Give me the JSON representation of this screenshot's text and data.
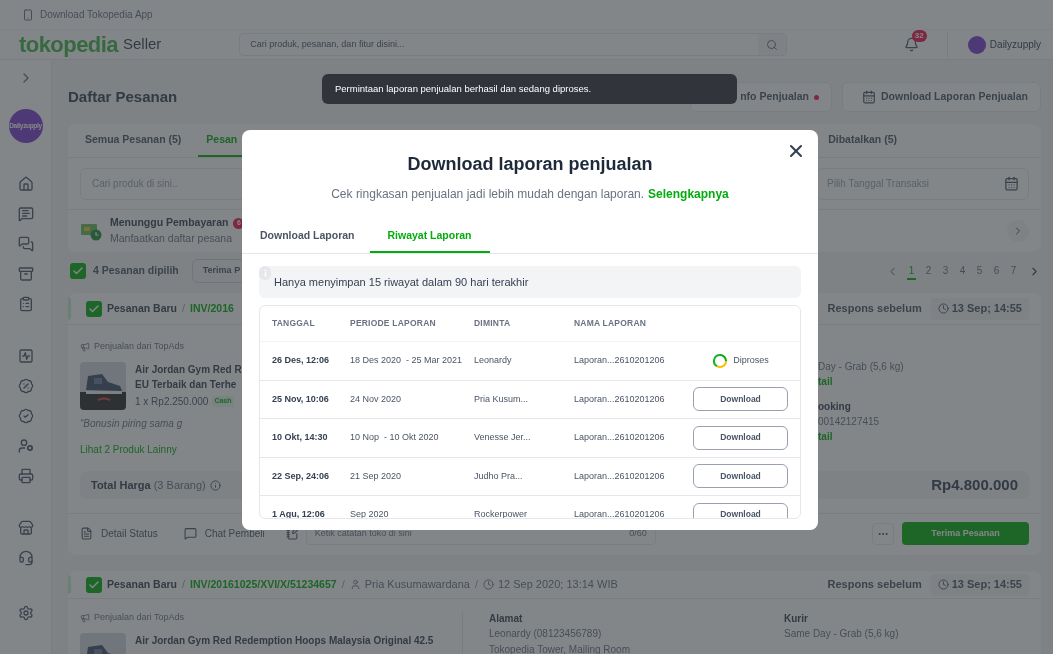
{
  "app_banner": {
    "text": "Download Tokopedia App"
  },
  "header": {
    "logo": "tokopedia",
    "logo_suffix": "Seller",
    "search": {
      "placeholder": "Cari produk, pesanan, dan fitur disini..."
    },
    "notification_count": "32",
    "shop": {
      "name": "Dailyzupply"
    }
  },
  "sidebar": {
    "avatar_label": "Dailyzupply"
  },
  "page": {
    "title": "Daftar Pesanan",
    "actions": [
      {
        "label": "nfo Penjualan",
        "has_update": true
      },
      {
        "label": "Download Laporan Penjualan",
        "has_update": false
      }
    ]
  },
  "toast": {
    "text": "Permintaan laporan penjualan berhasil dan sedang diproses."
  },
  "order_tabs": [
    {
      "label": "Semua Pesanan (5)",
      "selected": false
    },
    {
      "label": "Pesan",
      "selected": true
    },
    {
      "label": "Dibatalkan (5)",
      "selected": false
    }
  ],
  "filters": {
    "search_placeholder": "Cari produk di sini..",
    "date_placeholder": "Pilih Tanggal Transaksi"
  },
  "payment_notice": {
    "title": "Menunggu Pembayaran",
    "count": "6",
    "text": "Manfaatkan daftar pesana"
  },
  "selection": {
    "checked": true,
    "label": "4 Pesanan dipilih",
    "action": "Terima P"
  },
  "pagination": [
    {
      "label": "1",
      "selected": true
    },
    {
      "label": "2",
      "selected": false
    },
    {
      "label": "3",
      "selected": false
    },
    {
      "label": "4",
      "selected": false
    },
    {
      "label": "5",
      "selected": false
    },
    {
      "label": "6",
      "selected": false
    },
    {
      "label": "7",
      "selected": false
    }
  ],
  "orders": [
    {
      "checked": true,
      "status": "Pesanan Baru",
      "separators": [
        "/"
      ],
      "invoice": "INV/2016",
      "response_label": "Respons sebelum",
      "deadline": "13 Sep; 14:55",
      "source": "Penjualan dari TopAds",
      "product_lines": [
        "Air Jordan Gym Red R",
        "EU Terbaik dan Terhe"
      ],
      "price": "1 x Rp2.250.000",
      "badge": "Cash",
      "note": "“Bonusin piring sama g",
      "more_link": "Lihat 2 Produk Lainny",
      "side_lines": [
        {
          "kind": "text",
          "text": "Day - Grab (5,6 kg)"
        },
        {
          "kind": "link",
          "text": "tail"
        },
        {
          "kind": "heading",
          "text": "ooking"
        },
        {
          "kind": "text",
          "text": "00142127415"
        },
        {
          "kind": "link",
          "text": "tail"
        }
      ],
      "total_label": "Total Harga",
      "total_count": "(3 Barang)",
      "total": "Rp4.800.000",
      "footer": {
        "detail": "Detail Status",
        "chat": "Chat Pembeli",
        "note_placeholder": "Ketik catatan toko di sini",
        "note_count": "0/60",
        "accept": "Terima Pesanan"
      }
    },
    {
      "checked": true,
      "status": "Pesanan Baru",
      "separators": [
        "/",
        "/",
        "/"
      ],
      "invoice": "INV/20161025/XVI/X/51234657",
      "buyer": "Pria Kusumawardana",
      "ordered_at": "12 Sep 2020; 13:14 WIB",
      "response_label": "Respons sebelum",
      "deadline": "13 Sep; 14:55",
      "source": "Penjualan dari TopAds",
      "product_lines": [
        "Air Jordan Gym Red Redemption Hoops Malaysia Original 42.5"
      ],
      "address": {
        "label": "Alamat",
        "lines": [
          "Leonardy (08123456789)",
          "Tokopedia Tower, Mailing Room"
        ]
      },
      "courier": {
        "label": "Kurir",
        "lines": [
          "Same Day - Grab (5,6 kg)"
        ]
      }
    }
  ],
  "modal": {
    "title": "Download laporan penjualan",
    "subtitle": "Cek ringkasan penjualan jadi lebih mudah dengan laporan.",
    "link": "Selengkapnya",
    "tabs": [
      {
        "label": "Download Laporan",
        "selected": false
      },
      {
        "label": "Riwayat Laporan",
        "selected": true
      }
    ],
    "info": "Hanya menyimpan 15 riwayat dalam 90 hari terakhir",
    "columns": [
      "TANGGAL",
      "PERIODE LAPORAN",
      "DIMINTA",
      "NAMA LAPORAN"
    ],
    "rows": [
      {
        "date": "26 Des, 12:06",
        "period": "18 Des 2020  - 25 Mar 2021",
        "requested_by": "Leonardy",
        "name": "Laporan...2610201206",
        "kind": "processing",
        "action": "Diproses"
      },
      {
        "date": "25 Nov, 10:06",
        "period": "24 Nov 2020",
        "requested_by": "Pria Kusum...",
        "name": "Laporan...2610201206",
        "kind": "download",
        "action": "Download"
      },
      {
        "date": "10 Okt, 14:30",
        "period": "10 Nop  - 10 Okt 2020",
        "requested_by": "Venesse Jer...",
        "name": "Laporan...2610201206",
        "kind": "download",
        "action": "Download"
      },
      {
        "date": "22 Sep, 24:06",
        "period": "21 Sep 2020",
        "requested_by": "Judho Pra...",
        "name": "Laporan...2610201206",
        "kind": "download",
        "action": "Download"
      },
      {
        "date": "1 Agu, 12:06",
        "period": "Sep 2020",
        "requested_by": "Rockerpower",
        "name": "Laporan...2610201206",
        "kind": "download",
        "action": "Download"
      }
    ]
  }
}
